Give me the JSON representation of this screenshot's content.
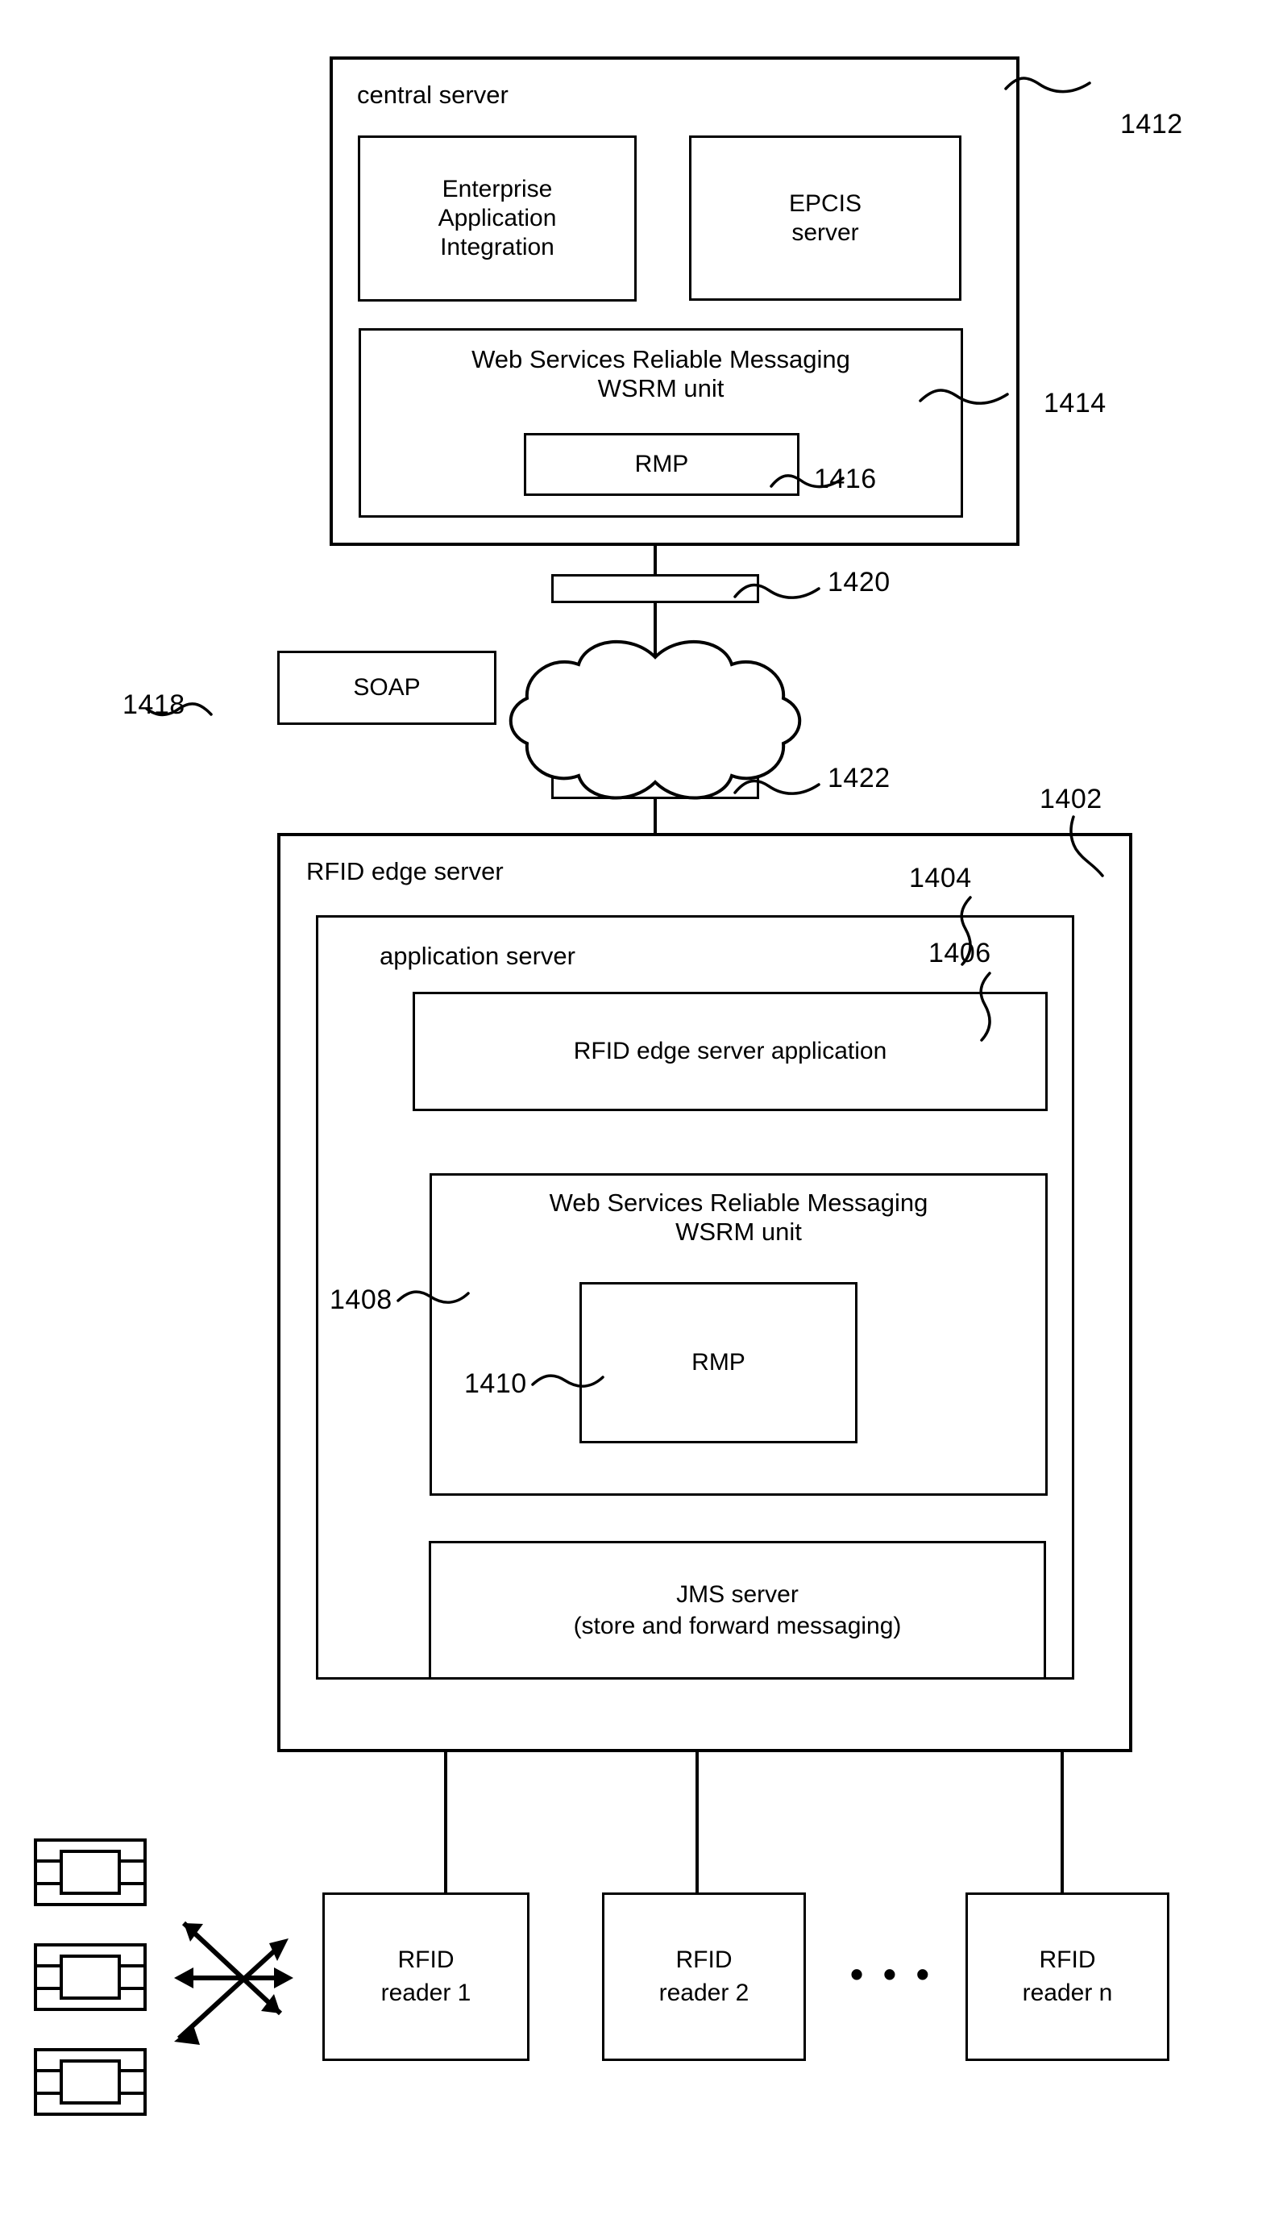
{
  "figure": {
    "type": "patent-block-diagram",
    "central_server": {
      "title": "central server",
      "ref": "1412",
      "blocks": [
        {
          "label": "Enterprise\nApplication\nIntegration",
          "name": "enterprise-application-integration"
        },
        {
          "label": "EPCIS\nserver",
          "name": "epcis-server"
        }
      ],
      "wsrm": {
        "label": "Web Services Reliable Messaging\nWSRM unit",
        "ref": "1414",
        "inner": {
          "label": "RMP",
          "ref": "1416"
        }
      }
    },
    "network": {
      "soap": {
        "label": "SOAP",
        "ref": "1418"
      },
      "bar_top": {
        "ref": "1420"
      },
      "bar_bottom": {
        "ref": "1422"
      },
      "cloud": {
        "label": ""
      }
    },
    "edge_server": {
      "title": "RFID edge server",
      "ref": "1402",
      "application_server": {
        "title": "application server",
        "ref": "1404",
        "edge_application": {
          "label": "RFID edge server application",
          "ref": "1406"
        },
        "wsrm": {
          "label": "Web Services Reliable Messaging\nWSRM unit",
          "ref": "1408",
          "inner": {
            "label": "RMP",
            "ref": "1410"
          }
        },
        "jms": {
          "label": "JMS server\n(store and forward messaging)"
        }
      }
    },
    "readers": [
      {
        "label": "RFID\nreader 1",
        "name": "rfid-reader-1"
      },
      {
        "label": "RFID\nreader 2",
        "name": "rfid-reader-2"
      },
      {
        "label": "RFID\nreader n",
        "name": "rfid-reader-n"
      }
    ],
    "reader_ellipsis": "• • •",
    "tags": [
      {
        "name": "rfid-tag-1"
      },
      {
        "name": "rfid-tag-2"
      },
      {
        "name": "rfid-tag-3"
      }
    ],
    "colors": {
      "ink": "#000000",
      "paper": "#ffffff"
    }
  }
}
